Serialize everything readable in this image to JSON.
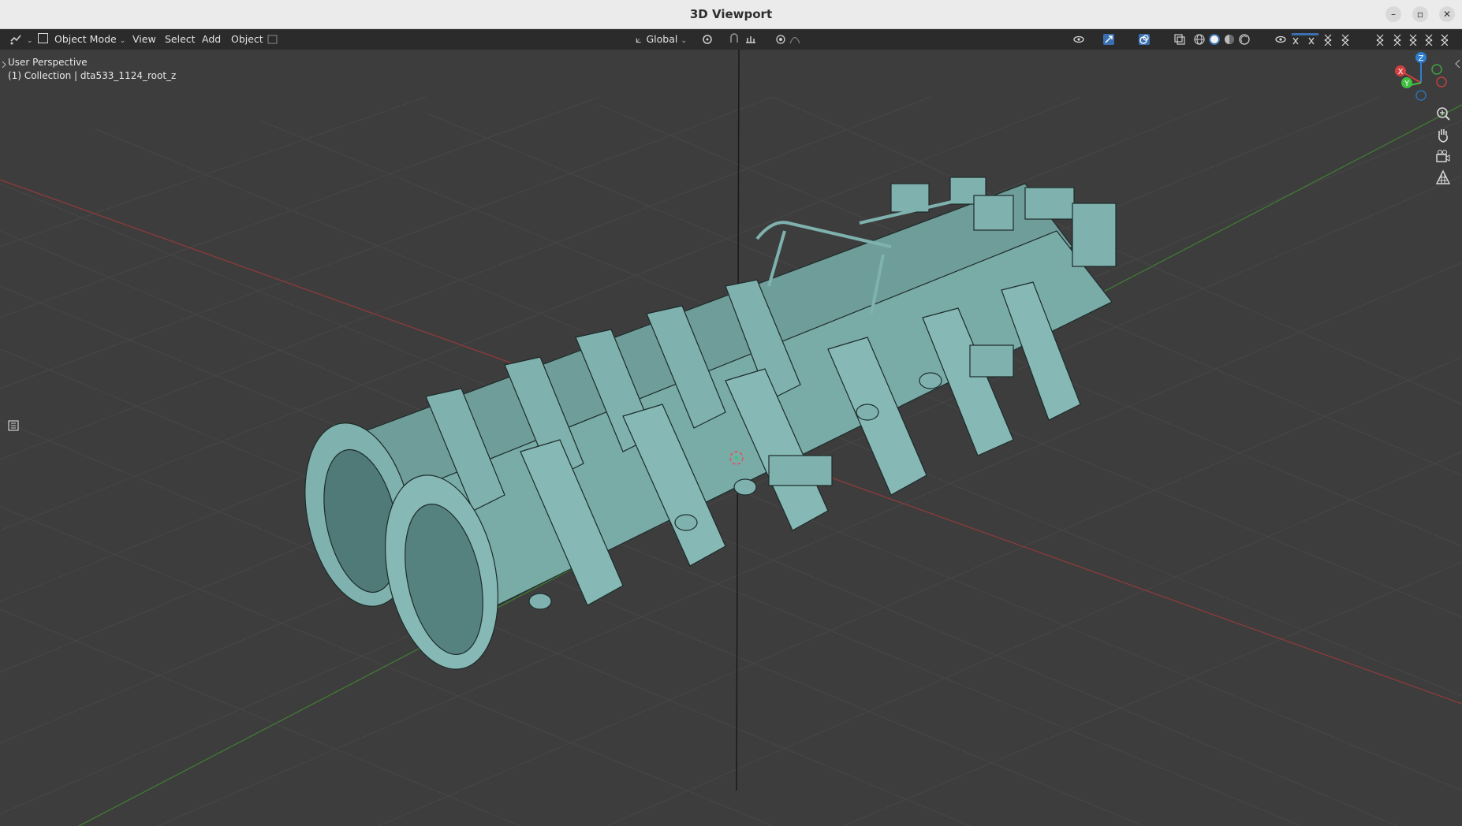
{
  "window": {
    "title": "3D Viewport",
    "controls": [
      "minimize-icon",
      "restore-icon",
      "close-icon"
    ]
  },
  "header": {
    "editor_type_icon": "editor-type-icon",
    "mode": "Object Mode",
    "menus": [
      "View",
      "Select",
      "Add",
      "Object"
    ],
    "transform_orientation": "Global"
  },
  "viewport": {
    "perspective_label": "User Perspective",
    "collection_label": "(1) Collection | dta533_1124_root_z",
    "object_color": "#7aaaa6",
    "x_axis_color": "#9b3a3a",
    "y_axis_color": "#4b8a3a"
  },
  "gizmo": {
    "axes": [
      "X",
      "Y",
      "Z"
    ]
  },
  "nav_icons": [
    "zoom-icon",
    "hand-pan-icon",
    "camera-icon",
    "grid-view-icon"
  ]
}
